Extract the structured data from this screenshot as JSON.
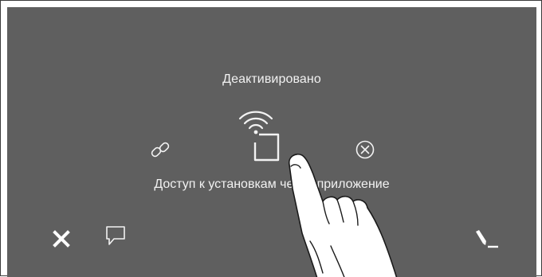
{
  "panel": {
    "status_text": "Деактивировано",
    "description": "Доступ к установкам через приложение"
  },
  "icons": {
    "link": "link-icon",
    "remote_access": "wifi-phone-icon",
    "cancel": "circle-x-icon",
    "close": "close-icon",
    "message": "speech-bubble-icon",
    "edit": "pen-icon"
  },
  "colors": {
    "background": "#5f5f5f",
    "foreground": "#f2f2f2"
  }
}
